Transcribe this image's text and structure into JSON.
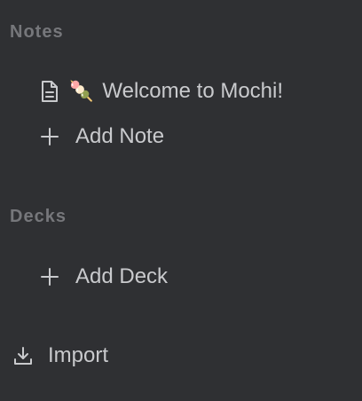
{
  "sidebar": {
    "notes": {
      "header": "Notes",
      "items": [
        {
          "emoji": "🍡",
          "label": "Welcome to Mochi!",
          "icon": "document-icon"
        }
      ],
      "add_label": "Add Note"
    },
    "decks": {
      "header": "Decks",
      "add_label": "Add Deck"
    },
    "import": {
      "label": "Import",
      "icon": "download-icon"
    }
  },
  "colors": {
    "background": "#2f3033",
    "header_text": "#76777b",
    "item_text": "#c9cacd"
  }
}
